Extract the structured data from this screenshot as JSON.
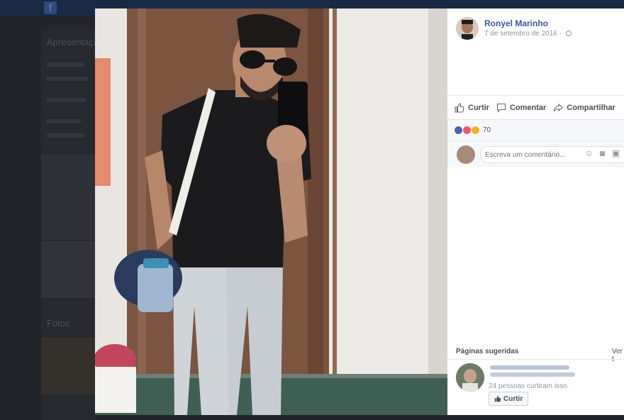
{
  "background": {
    "sidebar_title": "Apresentação",
    "photos_title": "Fotos"
  },
  "post": {
    "author": "Ronyel Marinho",
    "date": "7 de setembro de 2016",
    "privacy_icon": "globe-icon"
  },
  "actions": {
    "like": "Curtir",
    "comment": "Comentar",
    "share": "Compartilhar"
  },
  "reactions": {
    "icons": [
      "like-icon",
      "love-icon",
      "haha-icon"
    ],
    "count": "70"
  },
  "comment_box": {
    "placeholder": "Escreva um comentário..."
  },
  "suggested": {
    "title": "Páginas sugeridas",
    "see_all": "Ver t",
    "page_likes": "24 pessoas curtiram isso.",
    "like_button": "Curtir"
  },
  "colors": {
    "link_blue": "#365899",
    "like_blue": "#4267b2",
    "love_red": "#f25268",
    "haha_yellow": "#f7b125"
  }
}
